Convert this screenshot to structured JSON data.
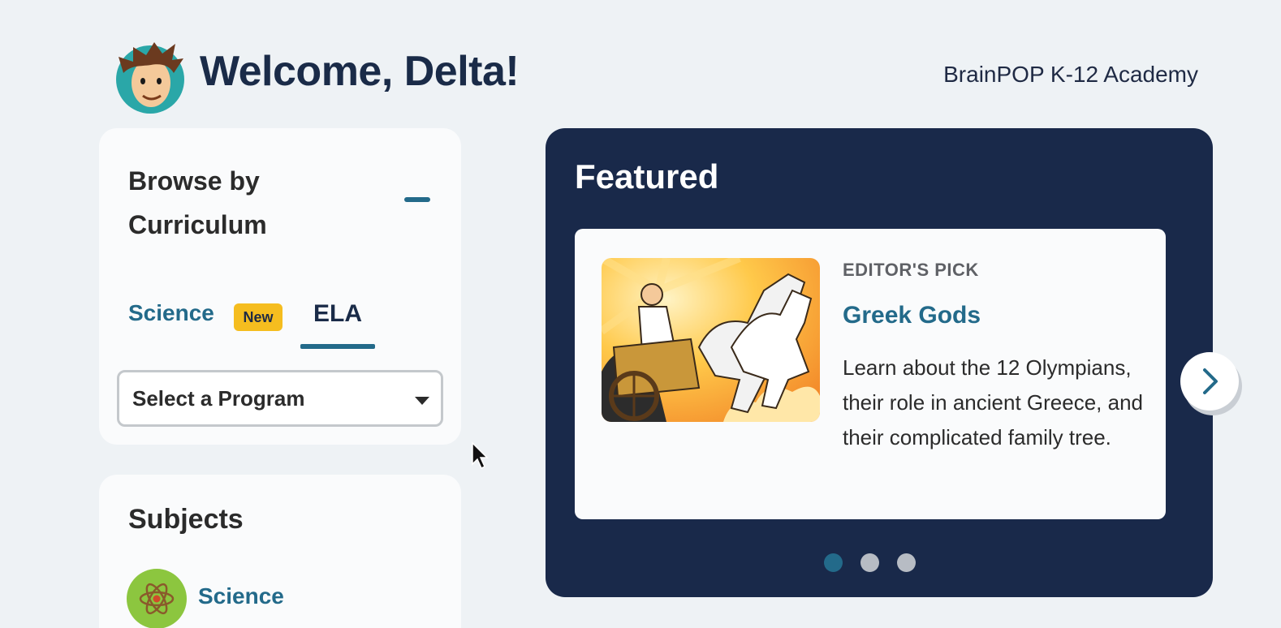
{
  "header": {
    "welcome": "Welcome, Delta!",
    "organization": "BrainPOP K-12 Academy"
  },
  "browse": {
    "title": "Browse by Curriculum",
    "tabs": [
      {
        "label": "Science",
        "badge": "New",
        "selected": false
      },
      {
        "label": "ELA",
        "selected": true
      }
    ],
    "program_select": {
      "value": "Select a Program"
    }
  },
  "subjects": {
    "title": "Subjects",
    "items": [
      {
        "label": "Science",
        "icon": "atom-icon",
        "color": "#8cc63f"
      }
    ]
  },
  "featured": {
    "title": "Featured",
    "card": {
      "kicker": "EDITOR'S PICK",
      "title": "Greek Gods",
      "description": "Learn about the 12 Olympians, their role in ancient Greece, and their complicated family tree.",
      "image": "greek-god-chariot-illustration"
    },
    "pagination": {
      "total": 3,
      "active": 1
    }
  },
  "colors": {
    "accent": "#236a8a",
    "featured_bg": "#19294a",
    "badge": "#f5bd1f",
    "page_bg": "#eef2f5"
  }
}
